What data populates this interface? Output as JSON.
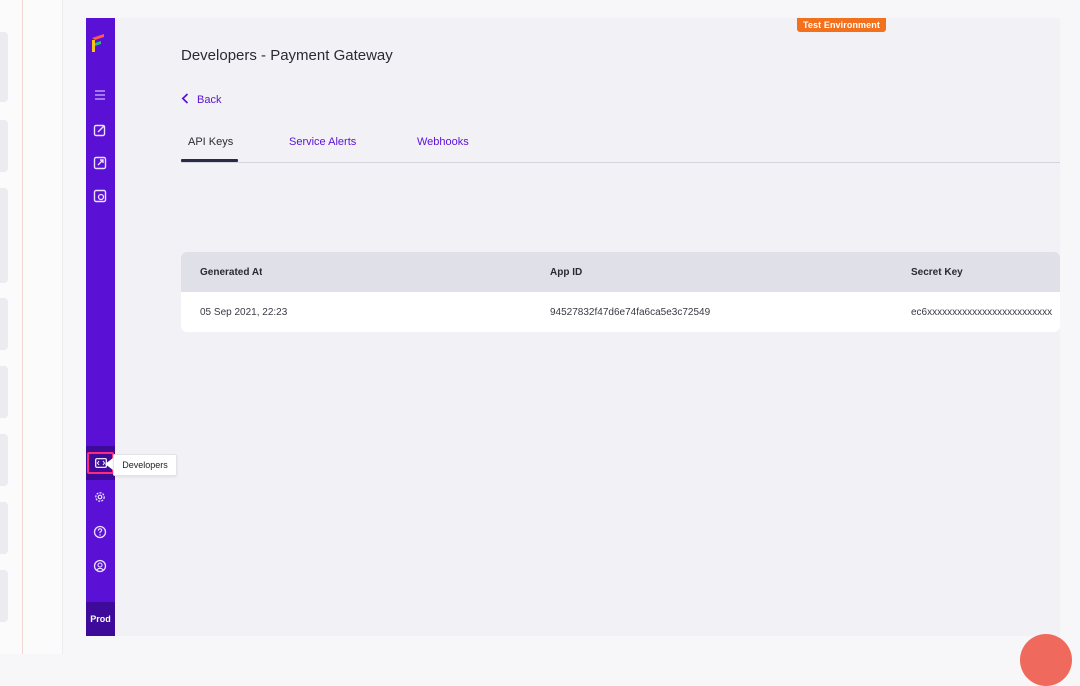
{
  "sidebar": {
    "prod_label": "Prod",
    "tooltip": "Developers"
  },
  "header": {
    "env_badge": "Test Environment",
    "title": "Developers - Payment Gateway",
    "back_label": "Back"
  },
  "tabs": [
    {
      "label": "API Keys",
      "active": true
    },
    {
      "label": "Service Alerts",
      "active": false
    },
    {
      "label": "Webhooks",
      "active": false
    }
  ],
  "table": {
    "columns": [
      "Generated At",
      "App ID",
      "Secret Key"
    ],
    "rows": [
      [
        "05 Sep 2021, 22:23",
        "94527832f47d6e74fa6ca5e3c72549",
        "ec6xxxxxxxxxxxxxxxxxxxxxxxxx"
      ]
    ]
  },
  "colors": {
    "brand": "#5b10d6",
    "brand_dark": "#3e0a9a",
    "env_badge": "#f3701c",
    "highlight": "#ff2b7a",
    "fab": "#ef6a5c"
  },
  "icons": [
    "menu-icon",
    "edit-icon",
    "export-icon",
    "refresh-icon",
    "developers-icon",
    "settings-icon",
    "help-icon",
    "account-icon",
    "back-chevron-icon"
  ]
}
